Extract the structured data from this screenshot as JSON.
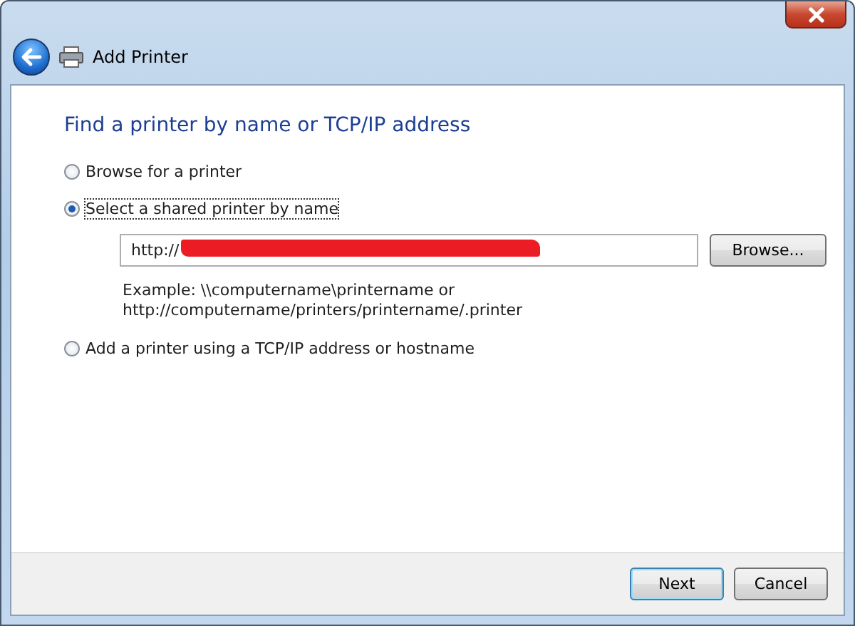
{
  "window": {
    "title": "Add Printer"
  },
  "heading": "Find a printer by name or TCP/IP address",
  "options": [
    {
      "label": "Browse for a printer",
      "selected": false
    },
    {
      "label": "Select a shared printer by name",
      "selected": true
    },
    {
      "label": "Add a printer using a TCP/IP address or hostname",
      "selected": false
    }
  ],
  "name_field": {
    "value": "http://",
    "redacted": true
  },
  "browse_button": "Browse...",
  "example": [
    "Example: \\\\computername\\printername or",
    "http://computername/printers/printername/.printer"
  ],
  "buttons": [
    {
      "label": "Next",
      "default": true
    },
    {
      "label": "Cancel",
      "default": false
    }
  ]
}
